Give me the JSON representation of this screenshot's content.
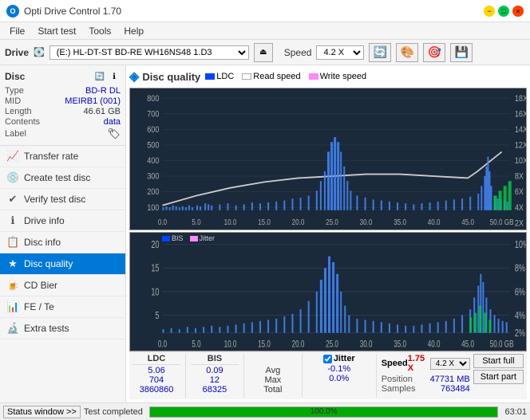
{
  "titlebar": {
    "title": "Opti Drive Control 1.70",
    "icon": "O",
    "min_label": "−",
    "max_label": "□",
    "close_label": "×"
  },
  "menubar": {
    "items": [
      "File",
      "Start test",
      "Tools",
      "Help"
    ]
  },
  "drivebar": {
    "drive_label": "Drive",
    "drive_value": "(E:) HL-DT-ST BD-RE  WH16NS48 1.D3",
    "speed_label": "Speed",
    "speed_value": "4.2 X"
  },
  "disc": {
    "title": "Disc",
    "type_label": "Type",
    "type_value": "BD-R DL",
    "mid_label": "MID",
    "mid_value": "MEIRB1 (001)",
    "length_label": "Length",
    "length_value": "46.61 GB",
    "contents_label": "Contents",
    "contents_value": "data",
    "label_label": "Label"
  },
  "nav": {
    "items": [
      {
        "id": "transfer-rate",
        "label": "Transfer rate",
        "icon": "📈"
      },
      {
        "id": "create-test-disc",
        "label": "Create test disc",
        "icon": "💿"
      },
      {
        "id": "verify-test-disc",
        "label": "Verify test disc",
        "icon": "✔"
      },
      {
        "id": "drive-info",
        "label": "Drive info",
        "icon": "ℹ"
      },
      {
        "id": "disc-info",
        "label": "Disc info",
        "icon": "📋"
      },
      {
        "id": "disc-quality",
        "label": "Disc quality",
        "icon": "★"
      },
      {
        "id": "cd-bier",
        "label": "CD Bier",
        "icon": "🍺"
      },
      {
        "id": "fe-te",
        "label": "FE / Te",
        "icon": "📊"
      },
      {
        "id": "extra-tests",
        "label": "Extra tests",
        "icon": "🔬"
      }
    ],
    "active": "disc-quality"
  },
  "disc_quality": {
    "title": "Disc quality",
    "legend": {
      "ldc_label": "LDC",
      "read_speed_label": "Read speed",
      "write_speed_label": "Write speed",
      "bis_label": "BIS",
      "jitter_label": "Jitter"
    }
  },
  "chart_top": {
    "title": "LDC / Read/Write speed",
    "y_max": 800,
    "y_labels": [
      "800",
      "700",
      "600",
      "500",
      "400",
      "300",
      "200",
      "100"
    ],
    "y_right_labels": [
      "18X",
      "16X",
      "14X",
      "12X",
      "10X",
      "8X",
      "6X",
      "4X",
      "2X"
    ],
    "x_labels": [
      "0.0",
      "5.0",
      "10.0",
      "15.0",
      "20.0",
      "25.0",
      "30.0",
      "35.0",
      "40.0",
      "45.0",
      "50.0 GB"
    ]
  },
  "chart_bottom": {
    "title": "BIS / Jitter",
    "y_max": 20,
    "y_labels": [
      "20",
      "15",
      "10",
      "5"
    ],
    "y_right_labels": [
      "10%",
      "8%",
      "6%",
      "4%",
      "2%"
    ],
    "x_labels": [
      "0.0",
      "5.0",
      "10.0",
      "15.0",
      "20.0",
      "25.0",
      "30.0",
      "35.0",
      "40.0",
      "45.0",
      "50.0 GB"
    ]
  },
  "stats": {
    "ldc_header": "LDC",
    "bis_header": "BIS",
    "jitter_header": "Jitter",
    "speed_header": "Speed",
    "avg_label": "Avg",
    "max_label": "Max",
    "total_label": "Total",
    "ldc_avg": "5.06",
    "ldc_max": "704",
    "ldc_total": "3860860",
    "bis_avg": "0.09",
    "bis_max": "12",
    "bis_total": "68325",
    "jitter_avg": "-0.1%",
    "jitter_max": "0.0%",
    "speed_value": "1.75 X",
    "speed_select": "4.2 X",
    "position_label": "Position",
    "position_value": "47731 MB",
    "samples_label": "Samples",
    "samples_value": "763484",
    "jitter_checked": true,
    "start_full_label": "Start full",
    "start_part_label": "Start part"
  },
  "statusbar": {
    "window_btn": "Status window >>",
    "status_text": "Test completed",
    "progress": 100,
    "progress_text": "100.0%",
    "time_text": "63:01"
  }
}
